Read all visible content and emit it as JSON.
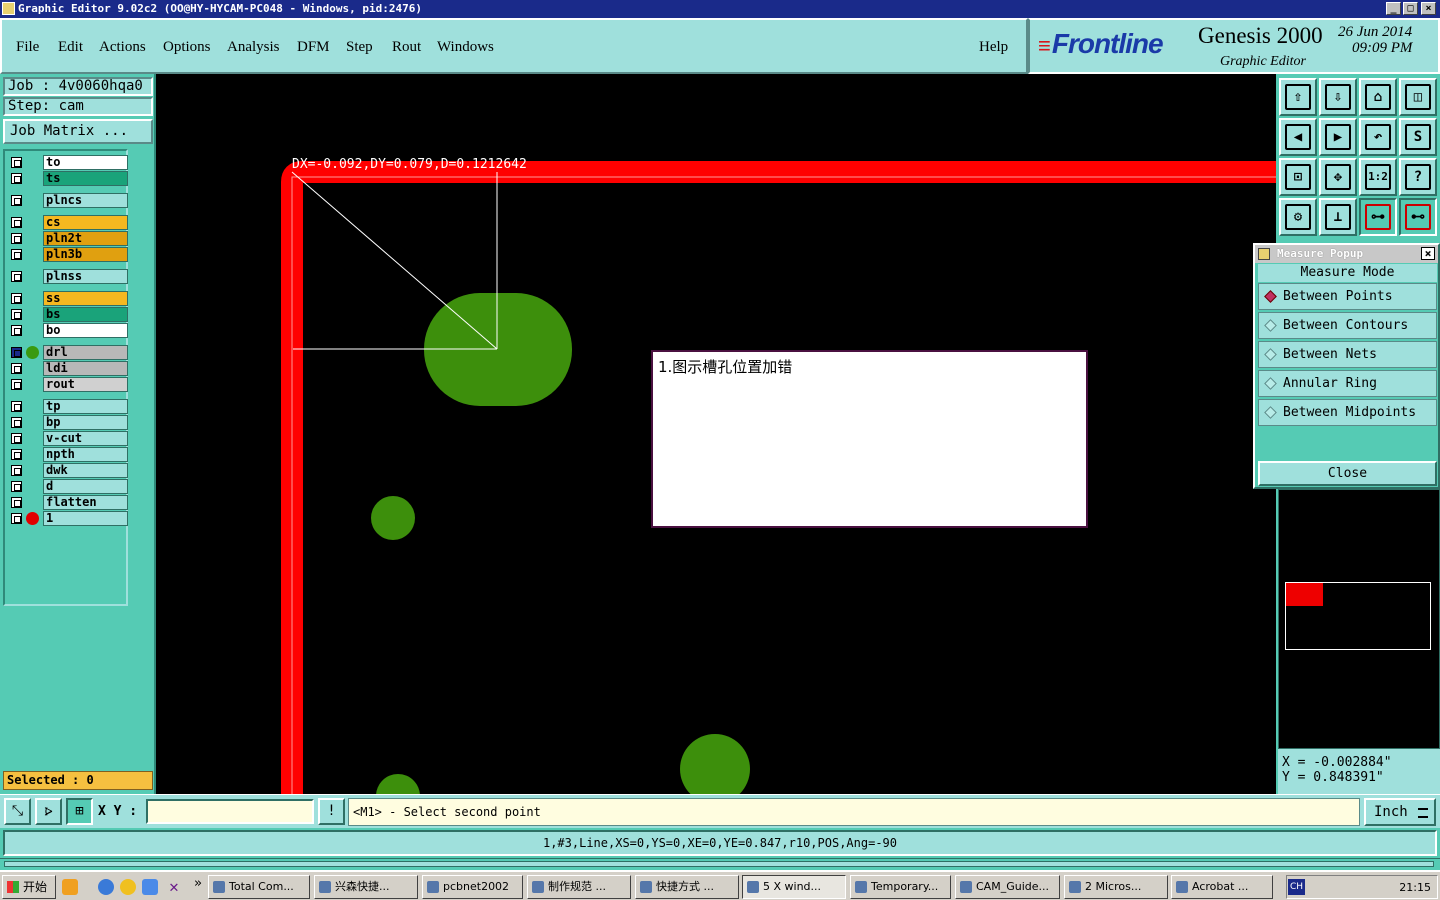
{
  "window": {
    "title": "Graphic Editor 9.02c2  (OO@HY-HYCAM-PC048 - Windows, pid:2476)",
    "minimize_glyph": "_",
    "maximize_glyph": "□",
    "close_glyph": "×"
  },
  "menu": {
    "file": "File",
    "edit": "Edit",
    "actions": "Actions",
    "options": "Options",
    "analysis": "Analysis",
    "dfm": "DFM",
    "step": "Step",
    "rout": "Rout",
    "windows": "Windows",
    "help": "Help"
  },
  "brand": {
    "logo": "Frontline",
    "logo_stripes": "≡",
    "product": "Genesis 2000",
    "subtitle": "Graphic Editor",
    "date": "26 Jun 2014",
    "time": "09:09 PM"
  },
  "job": {
    "job_label": "Job : 4v0060hqa0",
    "step_label": "Step: cam",
    "job_matrix": "Job Matrix ...",
    "selected": "Selected : 0"
  },
  "layers": [
    {
      "name": "to",
      "color": "#ffffff",
      "dot": ""
    },
    {
      "name": "ts",
      "color": "#1aa37a",
      "dot": ""
    },
    {
      "name": "plncs",
      "color": "#9fe0dc",
      "dot": ""
    },
    {
      "name": "cs",
      "color": "#f5b820",
      "dot": ""
    },
    {
      "name": "pln2t",
      "color": "#e0a010",
      "dot": ""
    },
    {
      "name": "pln3b",
      "color": "#e0a010",
      "dot": ""
    },
    {
      "name": "plnss",
      "color": "#9fe0dc",
      "dot": ""
    },
    {
      "name": "ss",
      "color": "#f5b820",
      "dot": ""
    },
    {
      "name": "bs",
      "color": "#1aa37a",
      "dot": ""
    },
    {
      "name": "bo",
      "color": "#ffffff",
      "dot": ""
    },
    {
      "name": "drl",
      "color": "#b8b8b8",
      "dot": "#3a9a10"
    },
    {
      "name": "ldi",
      "color": "#b8b8b8",
      "dot": ""
    },
    {
      "name": "rout",
      "color": "#d0d0d0",
      "dot": ""
    },
    {
      "name": "tp",
      "color": "#9fe0dc",
      "dot": ""
    },
    {
      "name": "bp",
      "color": "#9fe0dc",
      "dot": ""
    },
    {
      "name": "v-cut",
      "color": "#9fe0dc",
      "dot": ""
    },
    {
      "name": "npth",
      "color": "#9fe0dc",
      "dot": ""
    },
    {
      "name": "dwk",
      "color": "#9fe0dc",
      "dot": ""
    },
    {
      "name": "d",
      "color": "#9fe0dc",
      "dot": ""
    },
    {
      "name": "flatten",
      "color": "#9fe0dc",
      "dot": ""
    },
    {
      "name": "1",
      "color": "#9fe0dc",
      "dot": "#e00000"
    }
  ],
  "canvas": {
    "measure_readout": "DX=-0.092,DY=0.079,D=0.1212642",
    "annotation_text": "1.图示槽孔位置加错",
    "outline_color": "#ff0000",
    "pad_color": "#3d8f0c"
  },
  "toolbar": [
    {
      "name": "open-icon",
      "glyph": "⇧"
    },
    {
      "name": "save-icon",
      "glyph": "⇩"
    },
    {
      "name": "home-icon",
      "glyph": "⌂"
    },
    {
      "name": "split-view-icon",
      "glyph": "◫"
    },
    {
      "name": "pan-left-icon",
      "glyph": "◀"
    },
    {
      "name": "pan-right-icon",
      "glyph": "▶"
    },
    {
      "name": "undo-icon",
      "glyph": "↶"
    },
    {
      "name": "redraw-icon",
      "glyph": "S"
    },
    {
      "name": "fit-icon",
      "glyph": "⊡"
    },
    {
      "name": "center-icon",
      "glyph": "✥"
    },
    {
      "name": "zoom-ratio-icon",
      "glyph": "1:2"
    },
    {
      "name": "help-icon",
      "glyph": "?"
    },
    {
      "name": "tools-icon",
      "glyph": "⚙"
    },
    {
      "name": "snap-icon",
      "glyph": "⊥"
    },
    {
      "name": "net-highlight-icon",
      "glyph": "⊶"
    },
    {
      "name": "net-mode-icon",
      "glyph": "⊷"
    }
  ],
  "popup": {
    "title": "Measure Popup",
    "close_x": "×",
    "mode_header": "Measure Mode",
    "options": [
      {
        "label": "Between Points",
        "selected": true
      },
      {
        "label": "Between Contours",
        "selected": false
      },
      {
        "label": "Between Nets",
        "selected": false
      },
      {
        "label": "Annular Ring",
        "selected": false
      },
      {
        "label": "Between Midpoints",
        "selected": false
      }
    ],
    "close_label": "Close"
  },
  "coords": {
    "x": "X = -0.002884\"",
    "y": "Y =  0.848391\""
  },
  "command": {
    "xy_label": "X Y :",
    "xy_value": "",
    "alert_glyph": "!",
    "prompt": "<M1> - Select second point",
    "units": "Inch"
  },
  "feature_info": "1,#3,Line,XS=0,YS=0,XE=0,YE=0.847,r10,POS,Ang=-90",
  "taskbar": {
    "start": "开始",
    "more": "»",
    "tasks": [
      {
        "label": "Total Com...",
        "active": false
      },
      {
        "label": "兴森快捷...",
        "active": false
      },
      {
        "label": "pcbnet2002",
        "active": false
      },
      {
        "label": "制作规范 ...",
        "active": false
      },
      {
        "label": "快捷方式 ...",
        "active": false
      },
      {
        "label": "5 X wind...",
        "active": true
      },
      {
        "label": "Temporary...",
        "active": false
      },
      {
        "label": "CAM_Guide...",
        "active": false
      },
      {
        "label": "2 Micros...",
        "active": false
      },
      {
        "label": "Acrobat ...",
        "active": false
      }
    ],
    "lang": "CH",
    "clock": "21:15"
  }
}
